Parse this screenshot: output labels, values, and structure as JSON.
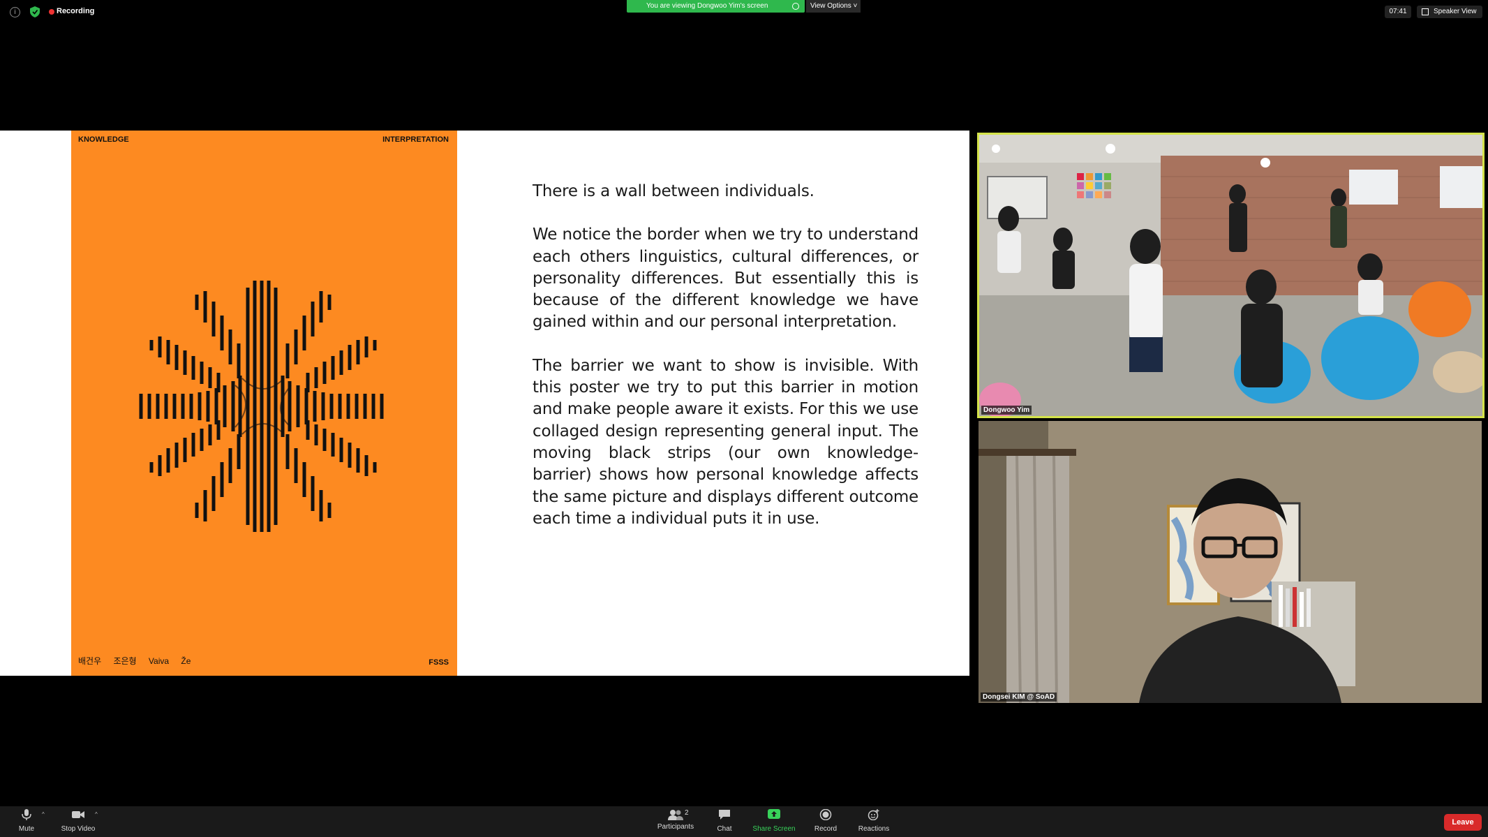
{
  "topbar": {
    "recording_label": "Recording",
    "viewing_banner": "You are viewing Dongwoo Yim's screen",
    "view_options_label": "View Options",
    "clock": "07:41",
    "speaker_view_label": "Speaker View"
  },
  "slide": {
    "poster": {
      "top_left": "KNOWLEDGE",
      "top_right": "INTERPRETATION",
      "bottom_left": "배건우 조은형 Vaiva Že",
      "bottom_right": "FSSS",
      "background_color": "#fd8a21"
    },
    "paragraphs": [
      "There is a wall between individuals.",
      "We notice the border when we try to understand each others linguistics, cultural differences, or personality differences. But essentially this is because of the different knowledge we have gained within and our personal interpretation.",
      "The barrier we want to show is invisible. With this poster we try to put this barrier in motion and make people aware it exists. For this we use collaged design representing general input. The moving black strips (our own knowledge- barrier) shows how personal knowledge affects the same picture and displays different outcome each time a individual puts it in use."
    ]
  },
  "participants_video": [
    {
      "name": "Dongwoo Yim",
      "active_speaker": true
    },
    {
      "name": "Dongsei KIM @ SoAD",
      "active_speaker": false
    }
  ],
  "toolbar": {
    "mute_label": "Mute",
    "stop_video_label": "Stop Video",
    "participants_label": "Participants",
    "participants_count": "2",
    "chat_label": "Chat",
    "share_screen_label": "Share Screen",
    "record_label": "Record",
    "reactions_label": "Reactions",
    "leave_label": "Leave"
  },
  "colors": {
    "share_green": "#2fb84d",
    "active_speaker_border": "#d4e34a",
    "leave_red": "#d92a2a"
  }
}
